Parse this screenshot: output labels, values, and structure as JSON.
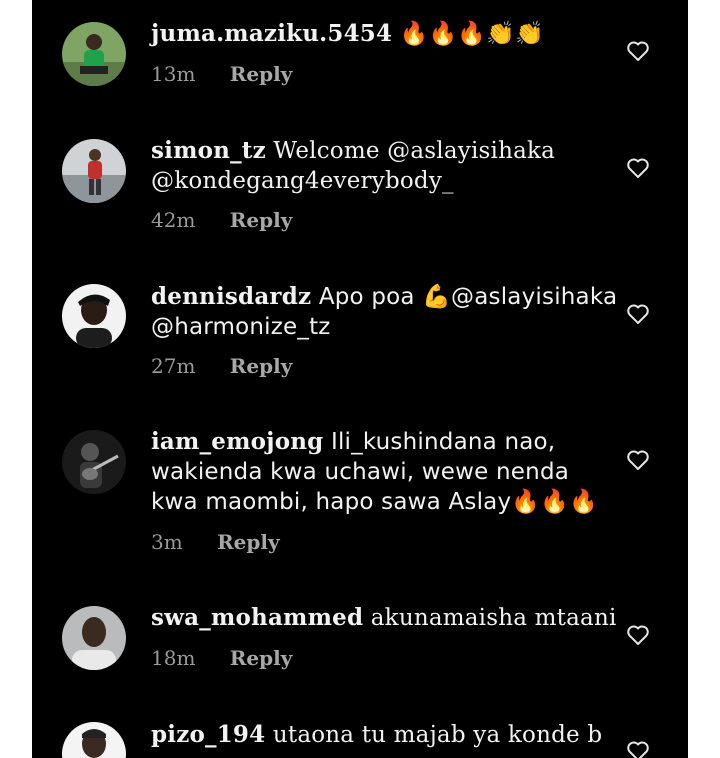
{
  "comments": [
    {
      "username": "juma.maziku.5454",
      "text": "🔥🔥🔥👏👏",
      "time": "13m",
      "reply_label": "Reply",
      "avatar": "avatar-green-shirt"
    },
    {
      "username": "simon_tz",
      "text": "Welcome @aslayisihaka @kondegang4everybody_",
      "time": "42m",
      "reply_label": "Reply",
      "avatar": "avatar-red-shirt"
    },
    {
      "username": "dennisdardz",
      "text": "Apo poa 💪@aslayisihaka @harmonize_tz",
      "time": "27m",
      "reply_label": "Reply",
      "avatar": "avatar-cap"
    },
    {
      "username": "iam_emojong",
      "text": "Ili_kushindana nao, wakienda kwa uchawi, wewe nenda kwa maombi, hapo sawa Aslay🔥🔥🔥",
      "time": "3m",
      "reply_label": "Reply",
      "avatar": "avatar-dark-guitar"
    },
    {
      "username": "swa_mohammed",
      "text": "akunamaisha mtaani",
      "time": "18m",
      "reply_label": "Reply",
      "avatar": "avatar-portrait"
    },
    {
      "username": "pizo_194",
      "text": "utaona tu majab ya konde b",
      "time": "",
      "reply_label": "",
      "avatar": "avatar-white-shirt"
    }
  ],
  "colors": {
    "background": "#000000",
    "text": "#f2f2f2",
    "meta": "#9a9a9a",
    "frame": "#ffffff"
  },
  "icons": {
    "like": "heart-outline-icon"
  }
}
